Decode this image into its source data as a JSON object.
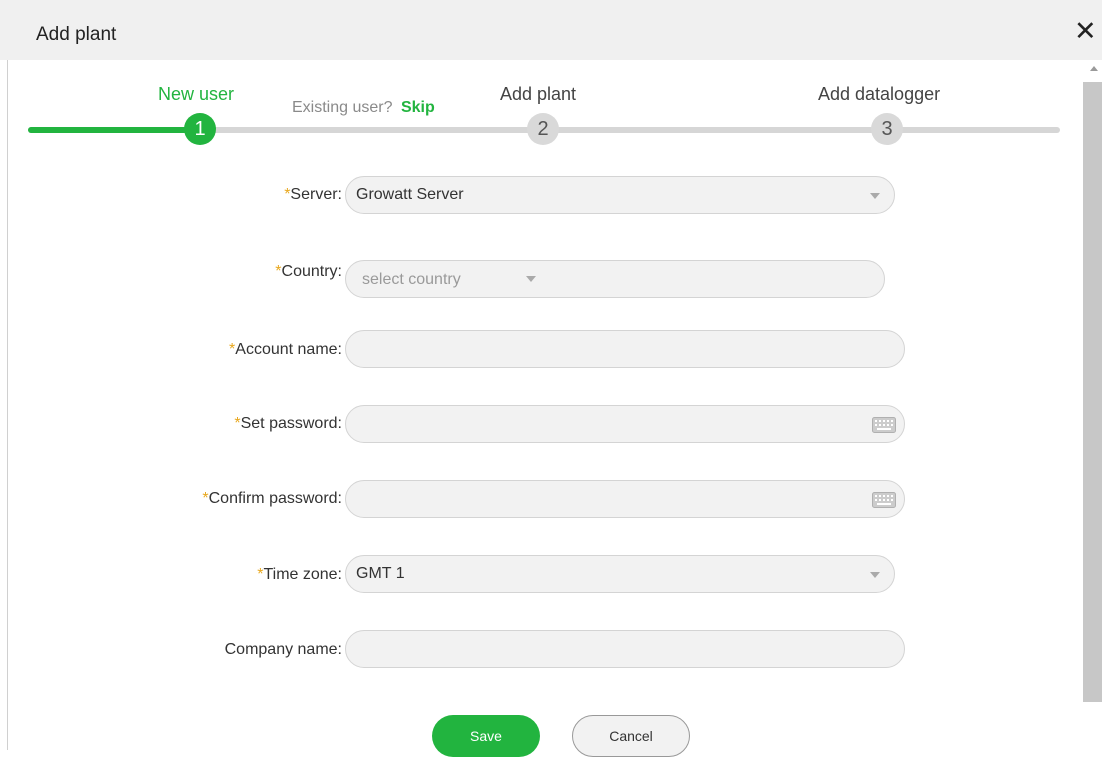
{
  "dialog": {
    "title": "Add plant",
    "close_glyph": "✕"
  },
  "stepper": {
    "steps": [
      {
        "number": "1",
        "label": "New user"
      },
      {
        "number": "2",
        "label": "Add plant"
      },
      {
        "number": "3",
        "label": "Add datalogger"
      }
    ],
    "existing_user_text": "Existing user?",
    "skip_label": "Skip",
    "active_step": 1
  },
  "form": {
    "required_mark": "*",
    "server": {
      "label": "Server:",
      "value": "Growatt Server"
    },
    "country": {
      "label": "Country:",
      "placeholder": "select country"
    },
    "account_name": {
      "label": "Account name:",
      "value": ""
    },
    "set_password": {
      "label": "Set password:",
      "value": ""
    },
    "confirm_password": {
      "label": "Confirm password:",
      "value": ""
    },
    "time_zone": {
      "label": "Time zone:",
      "value": "GMT 1"
    },
    "company_name": {
      "label": "Company name:",
      "value": ""
    }
  },
  "buttons": {
    "save": "Save",
    "cancel": "Cancel"
  },
  "colors": {
    "accent": "#22b43f",
    "required": "#e8a71d",
    "field_bg": "#f2f2f2"
  },
  "icons": {
    "close": "close-icon",
    "dropdown": "caret-down-icon",
    "keyboard": "keyboard-icon",
    "scroll_up": "scroll-up-arrow-icon"
  }
}
